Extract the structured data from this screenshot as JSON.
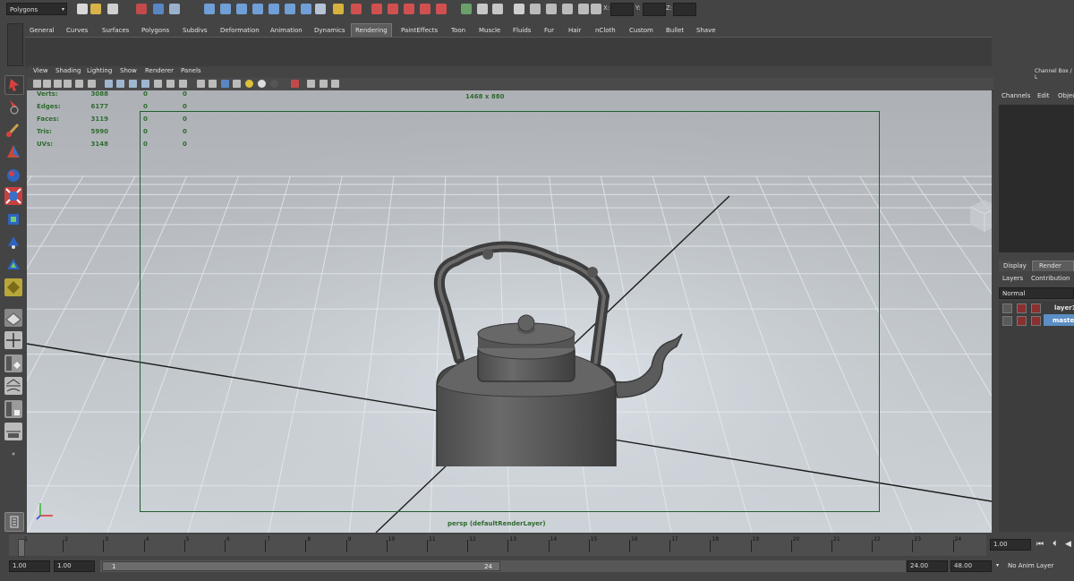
{
  "status_line": {
    "menu_set": "Polygons",
    "xyz_labels": [
      "X:",
      "Y:",
      "Z:"
    ]
  },
  "shelf_tabs": [
    "General",
    "Curves",
    "Surfaces",
    "Polygons",
    "Subdivs",
    "Deformation",
    "Animation",
    "Dynamics",
    "Rendering",
    "PaintEffects",
    "Toon",
    "Muscle",
    "Fluids",
    "Fur",
    "Hair",
    "nCloth",
    "Custom",
    "Bullet",
    "Shave"
  ],
  "active_shelf": "Rendering",
  "panel_menu": [
    "View",
    "Shading",
    "Lighting",
    "Show",
    "Renderer",
    "Panels"
  ],
  "hud": {
    "rows": [
      {
        "label": "Verts:",
        "v1": "3088",
        "v2": "0",
        "v3": "0"
      },
      {
        "label": "Edges:",
        "v1": "6177",
        "v2": "0",
        "v3": "0"
      },
      {
        "label": "Faces:",
        "v1": "3119",
        "v2": "0",
        "v3": "0"
      },
      {
        "label": "Tris:",
        "v1": "5990",
        "v2": "0",
        "v3": "0"
      },
      {
        "label": "UVs:",
        "v1": "3148",
        "v2": "0",
        "v3": "0"
      }
    ],
    "resolution": "1468 x 880",
    "camera": "persp (defaultRenderLayer)"
  },
  "channel_box": {
    "title": "Channel Box / L",
    "menus": [
      "Channels",
      "Edit",
      "Object"
    ]
  },
  "layer_editor": {
    "tabs": [
      "Display",
      "Render"
    ],
    "active_tab": "Render",
    "menus": [
      "Layers",
      "Contribution"
    ],
    "mode": "Normal",
    "layers": [
      "layer1",
      "masterLayer"
    ]
  },
  "time_slider": {
    "ticks": [
      "1",
      "2",
      "3",
      "4",
      "5",
      "6",
      "7",
      "8",
      "9",
      "10",
      "11",
      "12",
      "13",
      "14",
      "15",
      "16",
      "17",
      "18",
      "19",
      "20",
      "21",
      "22",
      "23",
      "24"
    ],
    "current_frame": "1.00"
  },
  "range_slider": {
    "start": "1.00",
    "start2": "1.00",
    "bar_start": "1",
    "bar_end": "24",
    "end": "24.00",
    "end2": "48.00",
    "anim_layer": "No Anim Layer"
  },
  "colors": {
    "ui_bg": "#444444",
    "field_bg": "#2b2b2b",
    "hud_text": "#2f6a2f",
    "selected_layer": "#5b8fc5"
  }
}
